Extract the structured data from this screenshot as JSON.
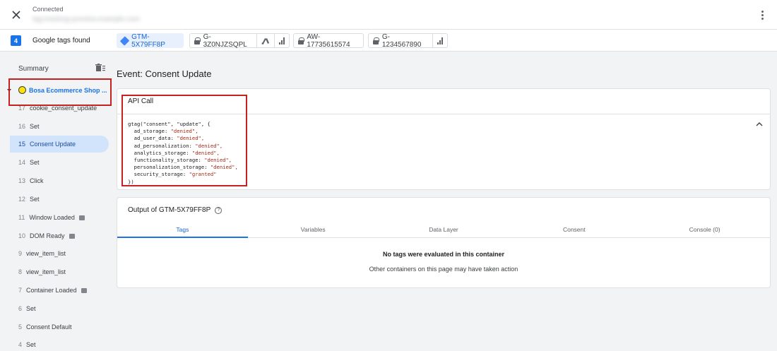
{
  "header": {
    "status": "Connected",
    "url": "tag-tracking-preview.example.com"
  },
  "tagbar": {
    "count": "4",
    "label": "Google tags found",
    "chips": [
      {
        "label": "GTM-5X79FF8P"
      },
      {
        "label": "G-3Z0NJZSQPL"
      },
      {
        "label": "AW-17735615574"
      },
      {
        "label": "G-1234567890"
      }
    ]
  },
  "sidebar": {
    "summary": "Summary",
    "site": "Bosa Ecommerce Shop ...",
    "events": [
      {
        "num": "17",
        "label": "cookie_consent_update"
      },
      {
        "num": "16",
        "label": "Set"
      },
      {
        "num": "15",
        "label": "Consent Update"
      },
      {
        "num": "14",
        "label": "Set"
      },
      {
        "num": "13",
        "label": "Click"
      },
      {
        "num": "12",
        "label": "Set"
      },
      {
        "num": "11",
        "label": "Window Loaded"
      },
      {
        "num": "10",
        "label": "DOM Ready"
      },
      {
        "num": "9",
        "label": "view_item_list"
      },
      {
        "num": "8",
        "label": "view_item_list"
      },
      {
        "num": "7",
        "label": "Container Loaded"
      },
      {
        "num": "6",
        "label": "Set"
      },
      {
        "num": "5",
        "label": "Consent Default"
      },
      {
        "num": "4",
        "label": "Set"
      }
    ]
  },
  "main": {
    "event_title": "Event: Consent Update",
    "api": {
      "title": "API Call",
      "code_open": "gtag(\"consent\", \"update\", {",
      "lines": [
        {
          "key": "ad_storage",
          "value": "\"denied\","
        },
        {
          "key": "ad_user_data",
          "value": "\"denied\","
        },
        {
          "key": "ad_personalization",
          "value": "\"denied\","
        },
        {
          "key": "analytics_storage",
          "value": "\"denied\","
        },
        {
          "key": "functionality_storage",
          "value": "\"denied\","
        },
        {
          "key": "personalization_storage",
          "value": "\"denied\","
        },
        {
          "key": "security_storage",
          "value": "\"granted\""
        }
      ],
      "code_close": "})"
    },
    "output": {
      "title": "Output of GTM-5X79FF8P",
      "tabs": [
        "Tags",
        "Variables",
        "Data Layer",
        "Consent",
        "Console (0)"
      ],
      "empty_main": "No tags were evaluated in this container",
      "empty_sub": "Other containers on this page may have taken action"
    }
  }
}
